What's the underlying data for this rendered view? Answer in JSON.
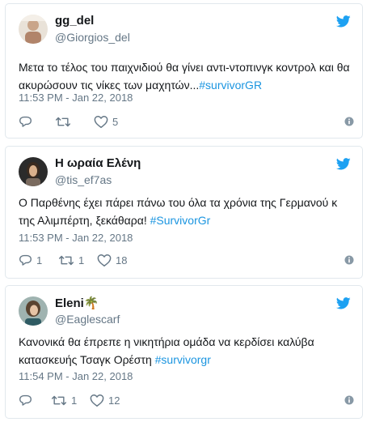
{
  "tweets": [
    {
      "name": "gg_del",
      "handle": "@Giorgios_del",
      "text_plain": "Μετα το τέλος του παιχνιδιού θα γίνει αντι-ντοπινγκ κοντρολ και θα ακυρώσουν τις νίκες των μαχητών...",
      "hashtag": "#survivorGR",
      "time": "11:53 PM - Jan 22, 2018",
      "replies": "",
      "retweets": "",
      "likes": "5",
      "avatar_icon": "profile-photo-avatar",
      "brand_color": "#1da1f2"
    },
    {
      "name": "Η ωραία Ελένη",
      "handle": "@tis_ef7as",
      "text_plain": "Ο Παρθένης έχει πάρει πάνω του όλα τα χρόνια της Γερμανού κ της Αλιμπέρτη, ξεκάθαρα! ",
      "hashtag": "#SurvivorGr",
      "time": "11:53 PM - Jan 22, 2018",
      "replies": "1",
      "retweets": "1",
      "likes": "18",
      "avatar_icon": "profile-photo-avatar",
      "brand_color": "#1da1f2"
    },
    {
      "name": "Eleni",
      "name_emoji": "🌴",
      "handle": "@Eaglescarf",
      "text_plain": "Κανονικά θα έπρεπε η νικητήρια ομάδα να κερδίσει καλύβα κατασκευής Τσαγκ Ορέστη ",
      "hashtag": "#survivorgr",
      "time": "11:54 PM - Jan 22, 2018",
      "replies": "",
      "retweets": "1",
      "likes": "12",
      "avatar_icon": "profile-photo-avatar",
      "brand_color": "#1da1f2"
    }
  ],
  "colors": {
    "hashtag": "#1b95e0",
    "muted": "#657786",
    "border": "#e1e8ed",
    "twitter_blue": "#1da1f2"
  }
}
